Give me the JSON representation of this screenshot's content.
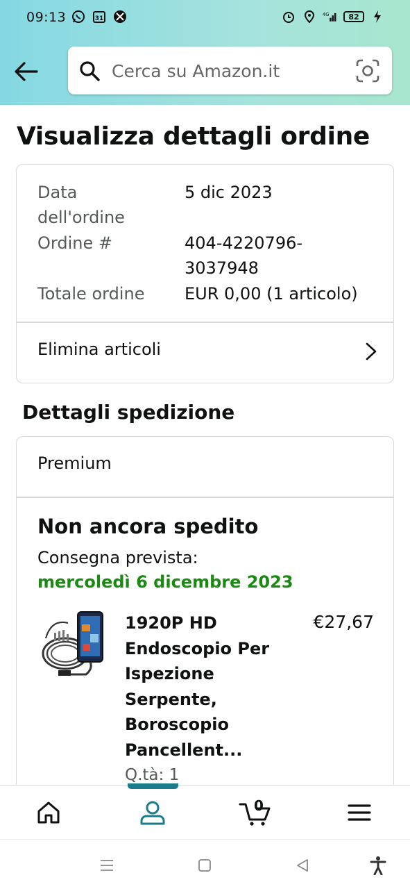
{
  "status_bar": {
    "time": "09:13",
    "battery": "82"
  },
  "search": {
    "placeholder": "Cerca su Amazon.it"
  },
  "page": {
    "title": "Visualizza dettagli ordine"
  },
  "order": {
    "date_label": "Data dell'ordine",
    "date_value": "5 dic 2023",
    "number_label": "Ordine #",
    "number_value": "404-4220796-3037948",
    "total_label": "Totale ordine",
    "total_value": "EUR 0,00 (1 articolo)",
    "delete_items_label": "Elimina articoli"
  },
  "shipping": {
    "section_title": "Dettagli spedizione",
    "service": "Premium",
    "status": "Non ancora spedito",
    "expected_label": "Consegna prevista:",
    "expected_date": "mercoledì 6 dicembre 2023",
    "product": {
      "title": "1920P HD Endoscopio Per Ispezione Serpente, Boroscopio Pancellent...",
      "price": "€27,67",
      "qty": "Q.tà: 1"
    }
  },
  "bottom_nav": {
    "cart_count": "0",
    "active": "account"
  },
  "colors": {
    "delivery_green": "#1a8a12",
    "active_nav": "#1a7c8a"
  }
}
